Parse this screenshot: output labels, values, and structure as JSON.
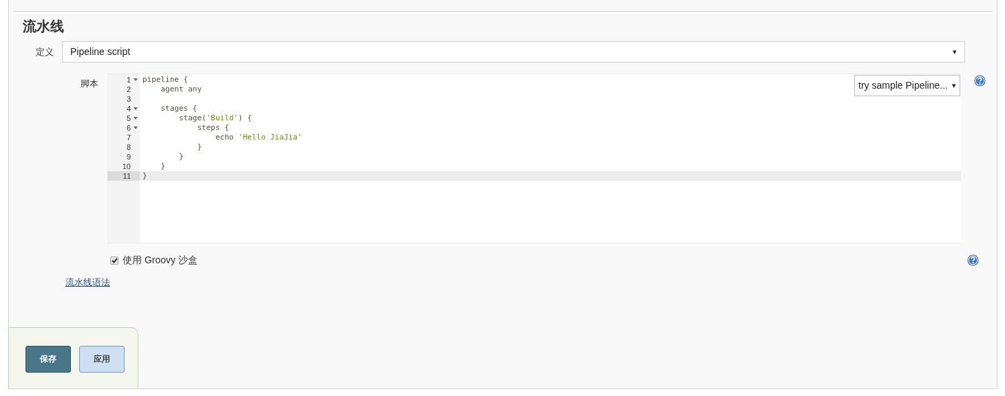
{
  "section": {
    "title": "流水线"
  },
  "definition": {
    "label": "定义",
    "value": "Pipeline script",
    "arrow": "▾"
  },
  "script": {
    "label": "脚本",
    "sample_select": {
      "value": "try sample Pipeline...",
      "arrow": "▾"
    },
    "lines": [
      {
        "number": "1",
        "foldable": true,
        "active": false,
        "tokens": [
          {
            "kind": "plain",
            "text": "pipeline {"
          }
        ]
      },
      {
        "number": "2",
        "foldable": false,
        "active": false,
        "tokens": [
          {
            "kind": "plain",
            "text": "    agent any"
          }
        ]
      },
      {
        "number": "3",
        "foldable": false,
        "active": false
      },
      {
        "number": "4",
        "foldable": true,
        "active": false,
        "tokens": [
          {
            "kind": "plain",
            "text": "    stages {"
          }
        ]
      },
      {
        "number": "5",
        "foldable": true,
        "active": false,
        "tokens": [
          {
            "kind": "plain",
            "text": "        stage("
          },
          {
            "kind": "string",
            "text": "'Build'"
          },
          {
            "kind": "plain",
            "text": ") {"
          }
        ]
      },
      {
        "number": "6",
        "foldable": true,
        "active": false,
        "tokens": [
          {
            "kind": "plain",
            "text": "            steps {"
          }
        ]
      },
      {
        "number": "7",
        "foldable": false,
        "active": false,
        "tokens": [
          {
            "kind": "plain",
            "text": "                echo "
          },
          {
            "kind": "string",
            "text": "'Hello JiaJia'"
          }
        ]
      },
      {
        "number": "8",
        "foldable": false,
        "active": false,
        "tokens": [
          {
            "kind": "plain",
            "text": "            }"
          }
        ]
      },
      {
        "number": "9",
        "foldable": false,
        "active": false,
        "tokens": [
          {
            "kind": "plain",
            "text": "        }"
          }
        ]
      },
      {
        "number": "10",
        "foldable": false,
        "active": false,
        "tokens": [
          {
            "kind": "plain",
            "text": "    }"
          }
        ]
      },
      {
        "number": "11",
        "foldable": false,
        "active": true,
        "tokens": [
          {
            "kind": "plain",
            "text": "}"
          }
        ]
      }
    ]
  },
  "sandbox": {
    "label": "使用 Groovy 沙盒",
    "checked": true
  },
  "syntax_link": "流水线语法",
  "buttons": [
    {
      "label": "保存",
      "kind": "primary"
    },
    {
      "label": "应用",
      "kind": "secondary"
    }
  ]
}
